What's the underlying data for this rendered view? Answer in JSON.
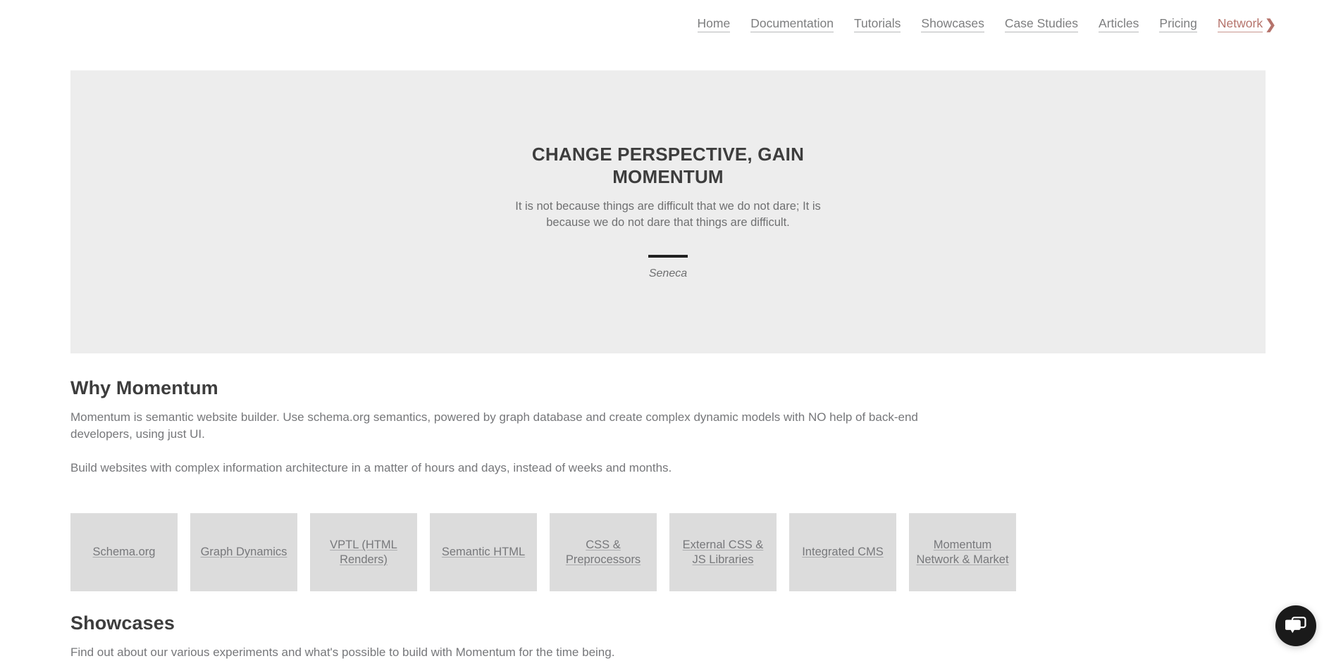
{
  "nav": {
    "items": [
      {
        "label": "Home",
        "accent": false
      },
      {
        "label": "Documentation",
        "accent": false
      },
      {
        "label": "Tutorials",
        "accent": false
      },
      {
        "label": "Showcases",
        "accent": false
      },
      {
        "label": "Case Studies",
        "accent": false
      },
      {
        "label": "Articles",
        "accent": false
      },
      {
        "label": "Pricing",
        "accent": false
      }
    ],
    "network_label": "Network",
    "network_chevron": "❯",
    "accent_color": "#b5736b",
    "link_color": "#7d7e7f"
  },
  "hero": {
    "title": "CHANGE PERSPECTIVE, GAIN MOMENTUM",
    "quote": "It is not because things are difficult that we do not dare; It is because we do not dare that things are difficult.",
    "author": "Seneca",
    "background_color": "#ededed",
    "rule_color": "#222222"
  },
  "why": {
    "title": "Why Momentum",
    "paragraph_1": "Momentum is semantic website builder. Use schema.org semantics, powered by graph database and create complex dynamic models with NO help of back-end developers, using just UI.",
    "paragraph_2": "Build websites with complex information architecture in a matter of hours and days, instead of weeks and months."
  },
  "features": {
    "box_color": "#dcdcdc",
    "items": [
      {
        "label": "Schema.org"
      },
      {
        "label": "Graph Dynamics"
      },
      {
        "label": "VPTL (HTML Renders)"
      },
      {
        "label": "Semantic HTML"
      },
      {
        "label": "CSS & Preprocessors"
      },
      {
        "label": "External CSS & JS Libraries"
      },
      {
        "label": "Integrated CMS"
      },
      {
        "label": "Momentum Network & Market"
      }
    ]
  },
  "showcases": {
    "title": "Showcases",
    "paragraph": "Find out about our various experiments and what's possible to build with Momentum for the time being."
  },
  "chat": {
    "icon": "chat-bubbles-icon",
    "background_color": "#1a1a1a"
  }
}
